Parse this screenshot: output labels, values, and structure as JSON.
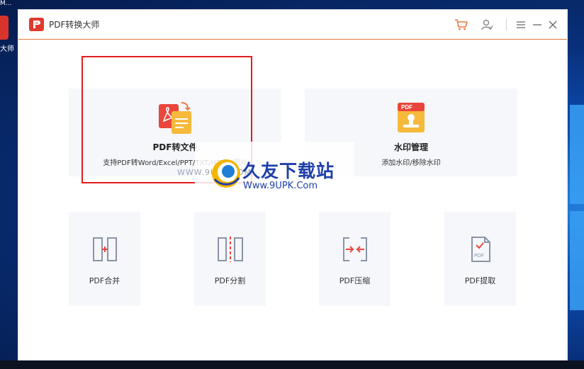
{
  "desktop": {
    "top_label": "M...",
    "icon_label": "大师"
  },
  "app": {
    "title": "PDF转换大师",
    "titlebar_icons": [
      "cart-icon",
      "user-icon",
      "menu-icon",
      "minimize-icon",
      "close-icon"
    ]
  },
  "main_cards": [
    {
      "title": "PDF转文件",
      "subtitle": "支持PDF转Word/Excel/PPT/TXT/HTML/图片"
    },
    {
      "title": "水印管理",
      "subtitle": "添加水印/移除水印"
    }
  ],
  "tools": [
    {
      "label": "PDF合并"
    },
    {
      "label": "PDF分割"
    },
    {
      "label": "PDF压缩"
    },
    {
      "label": "PDF提取"
    }
  ],
  "watermark": {
    "name": "久友下载站",
    "url": "Www.9UPK.Com",
    "ghost": "WWW.9UPK.COM"
  },
  "colors": {
    "accent": "#e77a3f",
    "brand_red": "#e03a2e",
    "selection": "#e01e1e",
    "card_bg": "#f5f7fb"
  }
}
